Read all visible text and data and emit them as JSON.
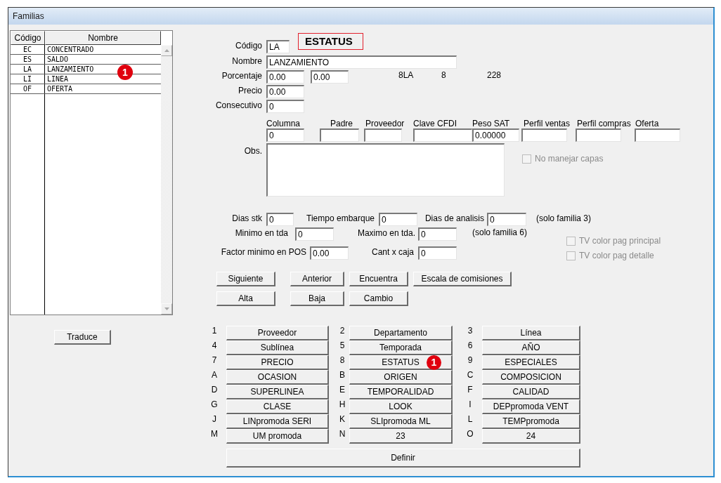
{
  "window": {
    "title": "Familias"
  },
  "table": {
    "columns": [
      "Código",
      "Nombre"
    ],
    "rows": [
      {
        "cells": [
          "EC",
          "CONCENTRADO"
        ]
      },
      {
        "cells": [
          "ES",
          "SALDO"
        ]
      },
      {
        "cells": [
          "LA",
          "LANZAMIENTO"
        ],
        "callout": "1"
      },
      {
        "cells": [
          "LI",
          "LINEA"
        ]
      },
      {
        "cells": [
          "OF",
          "OFERTA"
        ]
      }
    ]
  },
  "traduce_button": "Traduce",
  "header": {
    "codigo": {
      "label": "Código",
      "value": "LA"
    },
    "status_title": "ESTATUS",
    "nombre": {
      "label": "Nombre",
      "value": "LANZAMIENTO"
    },
    "porcentaje": {
      "label": "Porcentaje",
      "values": [
        "0.00",
        "0.00"
      ]
    },
    "info": [
      "8LA",
      "8",
      "228"
    ],
    "precio": {
      "label": "Precio",
      "value": "0.00"
    },
    "consecutivo": {
      "label": "Consecutivo",
      "value": "0"
    }
  },
  "column_fields": [
    {
      "label": "Columna",
      "value": "0"
    },
    {
      "label": "Padre"
    },
    {
      "label": "Proveedor"
    },
    {
      "label": "Clave CFDI"
    },
    {
      "label": "Peso SAT",
      "value": "0.00000"
    },
    {
      "label": "Perfil ventas"
    },
    {
      "label": "Perfil compras"
    },
    {
      "label": "Oferta"
    }
  ],
  "obs": {
    "label": "Obs."
  },
  "no_manejar_capas": {
    "label": "No manejar capas",
    "checked": false,
    "disabled": true
  },
  "stock_rows": [
    {
      "fields": [
        {
          "label": "Dias stk",
          "value": "0"
        },
        {
          "label": "Tiempo embarque",
          "value": "0"
        },
        {
          "label": "Dias de analisis",
          "value": "0"
        }
      ],
      "note": "(solo familia 3)"
    },
    {
      "fields": [
        {
          "label": "Minimo en tda",
          "value": "0"
        },
        {
          "label": "Maximo en tda.",
          "value": "0"
        }
      ],
      "note": "(solo familia 6)"
    },
    {
      "fields": [
        {
          "label": "Factor minimo en POS",
          "value": "0.00"
        },
        {
          "label": "Cant x caja",
          "value": "0"
        }
      ]
    }
  ],
  "tv_options": [
    {
      "label": "TV color pag principal",
      "checked": false,
      "disabled": true
    },
    {
      "label": "TV color pag detalle",
      "checked": false,
      "disabled": true
    }
  ],
  "action_buttons": [
    [
      "Siguiente",
      "Anterior",
      "Encuentra",
      "Escala de comisiones"
    ],
    [
      "Alta",
      "Baja",
      "Cambio"
    ]
  ],
  "catalog_buttons": [
    {
      "key": "1",
      "label": "Proveedor"
    },
    {
      "key": "2",
      "label": "Departamento"
    },
    {
      "key": "3",
      "label": "Línea"
    },
    {
      "key": "4",
      "label": "Sublínea"
    },
    {
      "key": "5",
      "label": "Temporada"
    },
    {
      "key": "6",
      "label": "AÑO"
    },
    {
      "key": "7",
      "label": "PRECIO"
    },
    {
      "key": "8",
      "label": "ESTATUS",
      "callout": "1"
    },
    {
      "key": "9",
      "label": "ESPECIALES"
    },
    {
      "key": "A",
      "label": "OCASION"
    },
    {
      "key": "B",
      "label": "ORIGEN"
    },
    {
      "key": "C",
      "label": "COMPOSICION"
    },
    {
      "key": "D",
      "label": "SUPERLINEA"
    },
    {
      "key": "E",
      "label": "TEMPORALIDAD"
    },
    {
      "key": "F",
      "label": "CALIDAD"
    },
    {
      "key": "G",
      "label": "CLASE"
    },
    {
      "key": "H",
      "label": "LOOK"
    },
    {
      "key": "I",
      "label": "DEPpromoda VENT"
    },
    {
      "key": "J",
      "label": "LINpromoda SERI"
    },
    {
      "key": "K",
      "label": "SLIpromoda ML"
    },
    {
      "key": "L",
      "label": "TEMPpromoda"
    },
    {
      "key": "M",
      "label": "UM promoda"
    },
    {
      "key": "N",
      "label": "23"
    },
    {
      "key": "O",
      "label": "24"
    }
  ],
  "definir_button": "Definir"
}
